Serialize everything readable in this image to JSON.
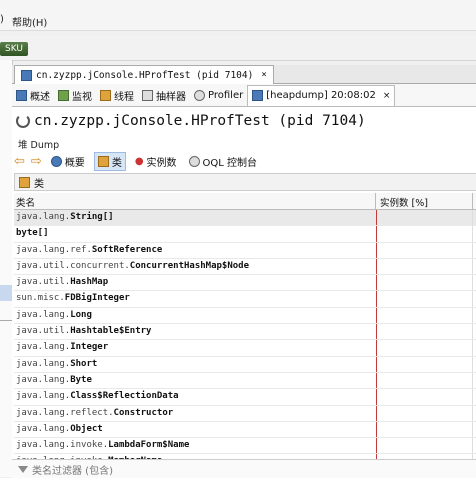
{
  "menubar": {
    "item_prefix": ")",
    "help_label": "帮助(H)"
  },
  "toolbar": {
    "left_badge": "SKU"
  },
  "tab": {
    "title": "cn.zyzpp.jConsole.HProfTest (pid 7104)",
    "close": "×"
  },
  "subtabs": [
    {
      "label": "概述",
      "icon": "overview-icon"
    },
    {
      "label": "监视",
      "icon": "monitor-icon"
    },
    {
      "label": "线程",
      "icon": "threads-icon"
    },
    {
      "label": "抽样器",
      "icon": "sampler-icon"
    },
    {
      "label": "Profiler",
      "icon": "profiler-icon"
    },
    {
      "label": "[heapdump] 20:08:02",
      "icon": "heapdump-icon",
      "active": true,
      "close": "×"
    }
  ],
  "main": {
    "title": "cn.zyzpp.jConsole.HProfTest (pid 7104)",
    "heapdump_label": "堆 Dump",
    "nav": [
      {
        "label": "概要"
      },
      {
        "label": "类",
        "active": true
      },
      {
        "label": "实例数"
      },
      {
        "label": "OQL 控制台"
      }
    ],
    "section_label": "类"
  },
  "table": {
    "headers": [
      "类名",
      "实例数 [%]"
    ],
    "rows": [
      {
        "pkg": "java.lang.",
        "cls": "String[]"
      },
      {
        "pkg": "",
        "cls": "byte[]"
      },
      {
        "pkg": "java.lang.ref.",
        "cls": "SoftReference"
      },
      {
        "pkg": "java.util.concurrent.",
        "cls": "ConcurrentHashMap$Node"
      },
      {
        "pkg": "java.util.",
        "cls": "HashMap"
      },
      {
        "pkg": "sun.misc.",
        "cls": "FDBigInteger"
      },
      {
        "pkg": "java.lang.",
        "cls": "Long"
      },
      {
        "pkg": "java.util.",
        "cls": "Hashtable$Entry"
      },
      {
        "pkg": "java.lang.",
        "cls": "Integer"
      },
      {
        "pkg": "java.lang.",
        "cls": "Short"
      },
      {
        "pkg": "java.lang.",
        "cls": "Byte"
      },
      {
        "pkg": "java.lang.",
        "cls": "Class$ReflectionData"
      },
      {
        "pkg": "java.lang.reflect.",
        "cls": "Constructor"
      },
      {
        "pkg": "java.lang.",
        "cls": "Object"
      },
      {
        "pkg": "java.lang.invoke.",
        "cls": "LambdaForm$Name"
      },
      {
        "pkg": "java.lang.invoke.",
        "cls": "MemberName"
      }
    ]
  },
  "filter": {
    "placeholder": "类名过滤器 (包含)"
  }
}
